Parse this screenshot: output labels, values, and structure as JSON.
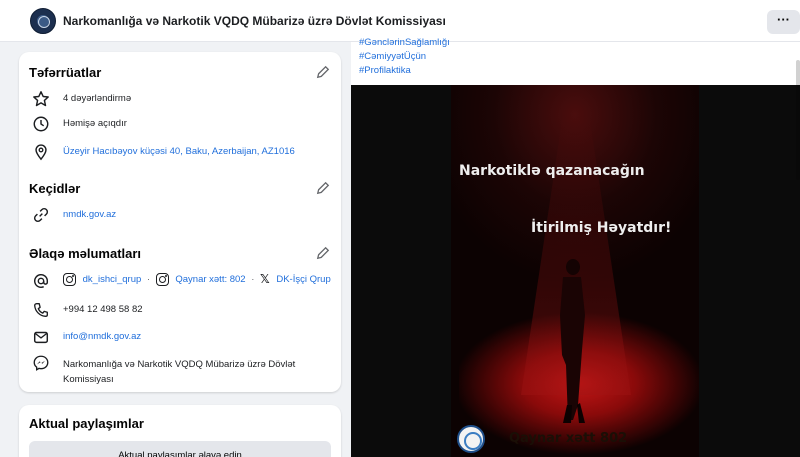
{
  "colors": {
    "link": "#216fdb",
    "accent_red": "#c21616",
    "card_bg": "#ffffff",
    "page_bg": "#f0f2f5"
  },
  "header": {
    "page_name": "Narkomanlığa və Narkotik VQDQ Mübarizə üzrə Dövlət Komissiyası",
    "more_label": "···",
    "more_icon": "more-icon"
  },
  "details": {
    "title": "Təfərrüatlar",
    "rating": {
      "icon": "star-icon",
      "text": "4 dəyərləndirmə"
    },
    "hours": {
      "icon": "clock-icon",
      "text": "Həmişə açıqdır"
    },
    "address": {
      "icon": "map-pin-icon",
      "text": "Üzeyir Hacıbəyov küçəsi 40, Baku, Azerbaijan, AZ1016"
    }
  },
  "links": {
    "title": "Keçidlər",
    "website": {
      "icon": "link-icon",
      "text": "nmdk.gov.az"
    }
  },
  "contacts": {
    "title": "Əlaqə məlumatları",
    "social": {
      "icon": "at-icon",
      "items": [
        {
          "icon": "instagram-icon",
          "text": "dk_ishci_qrup"
        },
        {
          "icon": "instagram-icon",
          "text": "Qaynar xətt: 802"
        },
        {
          "icon": "x-icon",
          "text": "DK-İşçi Qrup"
        }
      ],
      "separator": "·"
    },
    "phone": {
      "icon": "phone-icon",
      "text": "+994 12 498 58 82"
    },
    "email": {
      "icon": "mail-icon",
      "text": "info@nmdk.gov.az"
    },
    "messenger": {
      "icon": "messenger-icon",
      "line1": "Narkomanlığa və Narkotik VQDQ Mübarizə üzrə Dövlət",
      "line2": "Komissiyası"
    }
  },
  "featured": {
    "title": "Aktual paylaşımlar",
    "button_label": "Aktual paylaşımlar əlavə edin"
  },
  "post": {
    "hashtags": [
      "#GənclərinSağlamlığı",
      "#CəmiyyətÜçün",
      "#Profilaktika"
    ],
    "poster": {
      "line1": "Narkotiklə qazanacağın",
      "line2": "İtirilmiş Həyatdır!",
      "hotline": "Qaynar xətt 802"
    }
  }
}
